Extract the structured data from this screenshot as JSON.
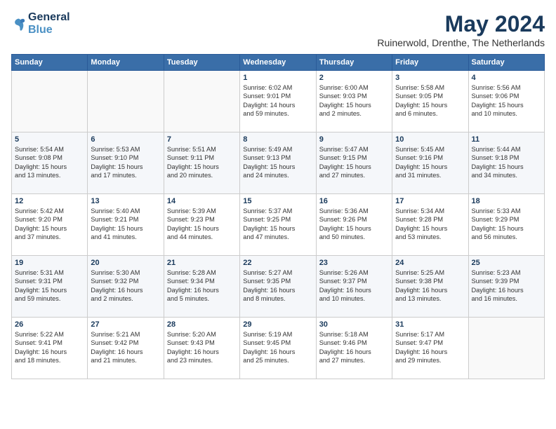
{
  "logo": {
    "line1": "General",
    "line2": "Blue"
  },
  "title": "May 2024",
  "subtitle": "Ruinerwold, Drenthe, The Netherlands",
  "headers": [
    "Sunday",
    "Monday",
    "Tuesday",
    "Wednesday",
    "Thursday",
    "Friday",
    "Saturday"
  ],
  "weeks": [
    [
      {
        "day": "",
        "info": ""
      },
      {
        "day": "",
        "info": ""
      },
      {
        "day": "",
        "info": ""
      },
      {
        "day": "1",
        "info": "Sunrise: 6:02 AM\nSunset: 9:01 PM\nDaylight: 14 hours\nand 59 minutes."
      },
      {
        "day": "2",
        "info": "Sunrise: 6:00 AM\nSunset: 9:03 PM\nDaylight: 15 hours\nand 2 minutes."
      },
      {
        "day": "3",
        "info": "Sunrise: 5:58 AM\nSunset: 9:05 PM\nDaylight: 15 hours\nand 6 minutes."
      },
      {
        "day": "4",
        "info": "Sunrise: 5:56 AM\nSunset: 9:06 PM\nDaylight: 15 hours\nand 10 minutes."
      }
    ],
    [
      {
        "day": "5",
        "info": "Sunrise: 5:54 AM\nSunset: 9:08 PM\nDaylight: 15 hours\nand 13 minutes."
      },
      {
        "day": "6",
        "info": "Sunrise: 5:53 AM\nSunset: 9:10 PM\nDaylight: 15 hours\nand 17 minutes."
      },
      {
        "day": "7",
        "info": "Sunrise: 5:51 AM\nSunset: 9:11 PM\nDaylight: 15 hours\nand 20 minutes."
      },
      {
        "day": "8",
        "info": "Sunrise: 5:49 AM\nSunset: 9:13 PM\nDaylight: 15 hours\nand 24 minutes."
      },
      {
        "day": "9",
        "info": "Sunrise: 5:47 AM\nSunset: 9:15 PM\nDaylight: 15 hours\nand 27 minutes."
      },
      {
        "day": "10",
        "info": "Sunrise: 5:45 AM\nSunset: 9:16 PM\nDaylight: 15 hours\nand 31 minutes."
      },
      {
        "day": "11",
        "info": "Sunrise: 5:44 AM\nSunset: 9:18 PM\nDaylight: 15 hours\nand 34 minutes."
      }
    ],
    [
      {
        "day": "12",
        "info": "Sunrise: 5:42 AM\nSunset: 9:20 PM\nDaylight: 15 hours\nand 37 minutes."
      },
      {
        "day": "13",
        "info": "Sunrise: 5:40 AM\nSunset: 9:21 PM\nDaylight: 15 hours\nand 41 minutes."
      },
      {
        "day": "14",
        "info": "Sunrise: 5:39 AM\nSunset: 9:23 PM\nDaylight: 15 hours\nand 44 minutes."
      },
      {
        "day": "15",
        "info": "Sunrise: 5:37 AM\nSunset: 9:25 PM\nDaylight: 15 hours\nand 47 minutes."
      },
      {
        "day": "16",
        "info": "Sunrise: 5:36 AM\nSunset: 9:26 PM\nDaylight: 15 hours\nand 50 minutes."
      },
      {
        "day": "17",
        "info": "Sunrise: 5:34 AM\nSunset: 9:28 PM\nDaylight: 15 hours\nand 53 minutes."
      },
      {
        "day": "18",
        "info": "Sunrise: 5:33 AM\nSunset: 9:29 PM\nDaylight: 15 hours\nand 56 minutes."
      }
    ],
    [
      {
        "day": "19",
        "info": "Sunrise: 5:31 AM\nSunset: 9:31 PM\nDaylight: 15 hours\nand 59 minutes."
      },
      {
        "day": "20",
        "info": "Sunrise: 5:30 AM\nSunset: 9:32 PM\nDaylight: 16 hours\nand 2 minutes."
      },
      {
        "day": "21",
        "info": "Sunrise: 5:28 AM\nSunset: 9:34 PM\nDaylight: 16 hours\nand 5 minutes."
      },
      {
        "day": "22",
        "info": "Sunrise: 5:27 AM\nSunset: 9:35 PM\nDaylight: 16 hours\nand 8 minutes."
      },
      {
        "day": "23",
        "info": "Sunrise: 5:26 AM\nSunset: 9:37 PM\nDaylight: 16 hours\nand 10 minutes."
      },
      {
        "day": "24",
        "info": "Sunrise: 5:25 AM\nSunset: 9:38 PM\nDaylight: 16 hours\nand 13 minutes."
      },
      {
        "day": "25",
        "info": "Sunrise: 5:23 AM\nSunset: 9:39 PM\nDaylight: 16 hours\nand 16 minutes."
      }
    ],
    [
      {
        "day": "26",
        "info": "Sunrise: 5:22 AM\nSunset: 9:41 PM\nDaylight: 16 hours\nand 18 minutes."
      },
      {
        "day": "27",
        "info": "Sunrise: 5:21 AM\nSunset: 9:42 PM\nDaylight: 16 hours\nand 21 minutes."
      },
      {
        "day": "28",
        "info": "Sunrise: 5:20 AM\nSunset: 9:43 PM\nDaylight: 16 hours\nand 23 minutes."
      },
      {
        "day": "29",
        "info": "Sunrise: 5:19 AM\nSunset: 9:45 PM\nDaylight: 16 hours\nand 25 minutes."
      },
      {
        "day": "30",
        "info": "Sunrise: 5:18 AM\nSunset: 9:46 PM\nDaylight: 16 hours\nand 27 minutes."
      },
      {
        "day": "31",
        "info": "Sunrise: 5:17 AM\nSunset: 9:47 PM\nDaylight: 16 hours\nand 29 minutes."
      },
      {
        "day": "",
        "info": ""
      }
    ]
  ],
  "colors": {
    "header_bg": "#3a6ea8",
    "title_color": "#1a3a5c"
  }
}
